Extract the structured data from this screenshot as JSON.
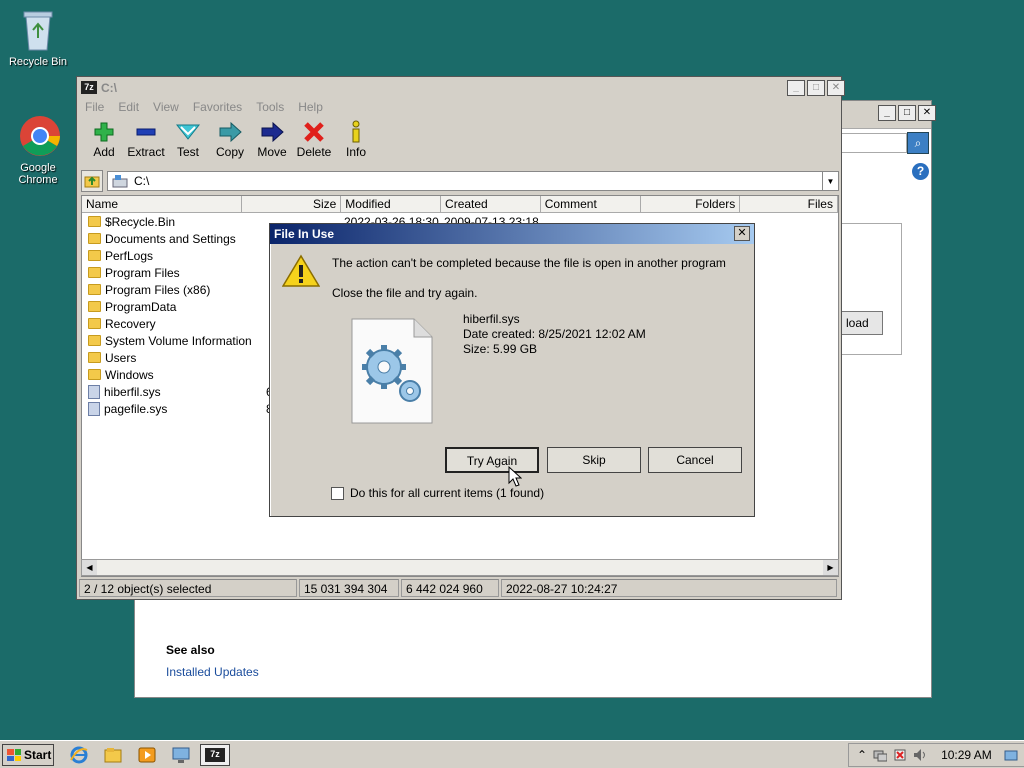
{
  "desktop": {
    "icons": [
      {
        "label": "Recycle Bin"
      },
      {
        "label": "Google Chrome"
      }
    ]
  },
  "background_window": {
    "partial_button_label": "load",
    "see_also": "See also",
    "link": "Installed Updates"
  },
  "zip_window": {
    "title": "C:\\",
    "logo_text": "7z",
    "menu": [
      "File",
      "Edit",
      "View",
      "Favorites",
      "Tools",
      "Help"
    ],
    "toolbar": [
      {
        "label": "Add",
        "icon": "add-icon"
      },
      {
        "label": "Extract",
        "icon": "extract-icon"
      },
      {
        "label": "Test",
        "icon": "test-icon"
      },
      {
        "label": "Copy",
        "icon": "copy-icon"
      },
      {
        "label": "Move",
        "icon": "move-icon"
      },
      {
        "label": "Delete",
        "icon": "delete-icon"
      },
      {
        "label": "Info",
        "icon": "info-icon"
      }
    ],
    "address": "C:\\",
    "columns": [
      "Name",
      "Size",
      "Modified",
      "Created",
      "Comment",
      "Folders",
      "Files"
    ],
    "first_row_modified": "2022-03-26 18:30",
    "first_row_created": "2009-07-13 23:18",
    "rows": [
      {
        "name": "$Recycle.Bin",
        "type": "folder"
      },
      {
        "name": "Documents and Settings",
        "type": "folder"
      },
      {
        "name": "PerfLogs",
        "type": "folder"
      },
      {
        "name": "Program Files",
        "type": "folder"
      },
      {
        "name": "Program Files (x86)",
        "type": "folder"
      },
      {
        "name": "ProgramData",
        "type": "folder"
      },
      {
        "name": "Recovery",
        "type": "folder"
      },
      {
        "name": "System Volume Information",
        "type": "folder"
      },
      {
        "name": "Users",
        "type": "folder"
      },
      {
        "name": "Windows",
        "type": "folder"
      },
      {
        "name": "hiberfil.sys",
        "type": "file",
        "size_partial": "6"
      },
      {
        "name": "pagefile.sys",
        "type": "file",
        "size_partial": "8"
      }
    ],
    "status": {
      "selected": "2 / 12 object(s) selected",
      "size_total": "15 031 394 304",
      "size_selected": "6 442 024 960",
      "modified": "2022-08-27 10:24:27"
    }
  },
  "dialog": {
    "title": "File In Use",
    "message": "The action can't be completed because the file is open in another program",
    "hint": "Close the file and try again.",
    "file_name": "hiberfil.sys",
    "date_created": "Date created: 8/25/2021 12:02 AM",
    "size": "Size: 5.99 GB",
    "buttons": {
      "try_again": "Try Again",
      "skip": "Skip",
      "cancel": "Cancel"
    },
    "checkbox_label": "Do this for all current items (1 found)"
  },
  "taskbar": {
    "start": "Start",
    "clock": "10:29 AM"
  }
}
